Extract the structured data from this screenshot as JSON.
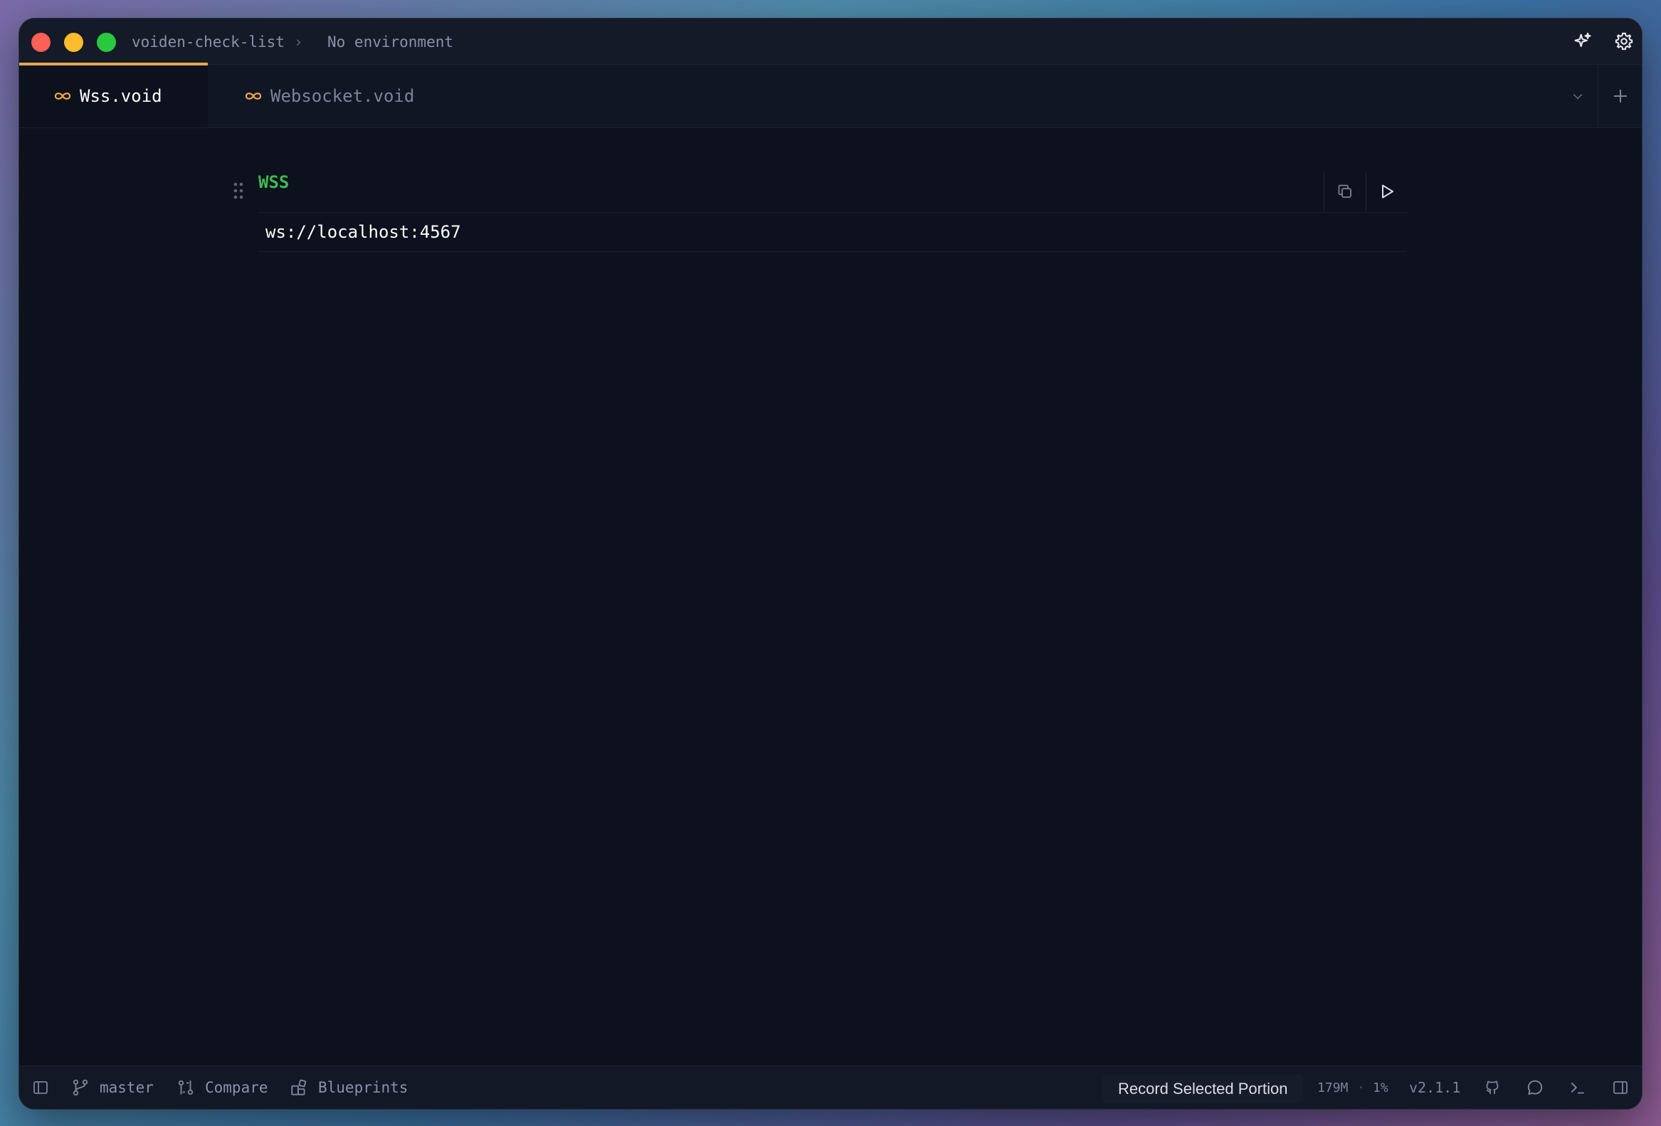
{
  "titlebar": {
    "project": "voiden-check-list",
    "separator": "›",
    "environment": "No environment",
    "icons": [
      "sparkle-icon",
      "gear-icon"
    ]
  },
  "tabs": [
    {
      "label": "Wss.void",
      "icon": "infinity-icon",
      "active": true
    },
    {
      "label": "Websocket.void",
      "icon": "infinity-icon",
      "active": false
    }
  ],
  "tabbar_actions": [
    "chevron-down-icon",
    "plus-icon"
  ],
  "block": {
    "label": "WSS",
    "url": "ws://localhost:4567",
    "actions": [
      "copy-icon",
      "play-icon"
    ]
  },
  "statusbar": {
    "branch": "master",
    "compare": "Compare",
    "blueprints": "Blueprints",
    "record_label": "Record Selected Portion",
    "memory": "179M",
    "dot": "·",
    "cpu": "1%",
    "version": "v2.1.1",
    "right_icons": [
      "github-icon",
      "chat-icon",
      "terminal-icon",
      "panel-icon"
    ]
  },
  "colors": {
    "accent": "#e6a94a",
    "method": "#3fb94f",
    "background": "#0c111d"
  }
}
